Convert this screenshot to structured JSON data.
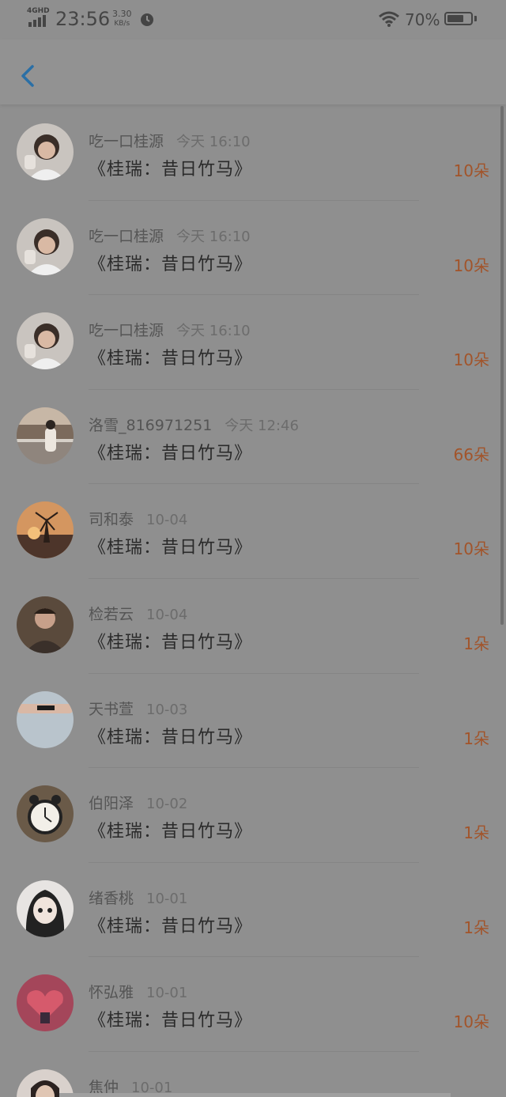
{
  "status_bar": {
    "network": "4GHD",
    "time": "23:56",
    "speed_value": "3.30",
    "speed_unit": "KB/s",
    "battery": "70%",
    "battery_level": 0.7
  },
  "header": {
    "back_icon": "chevron-left-icon",
    "accent": "#2a6fa6"
  },
  "list": [
    {
      "name": "吃一口桂源",
      "date": "今天 16:10",
      "title": "《桂瑞：昔日竹马》",
      "count": "10朵",
      "avatar": "avatar-person-1"
    },
    {
      "name": "吃一口桂源",
      "date": "今天 16:10",
      "title": "《桂瑞：昔日竹马》",
      "count": "10朵",
      "avatar": "avatar-person-1"
    },
    {
      "name": "吃一口桂源",
      "date": "今天 16:10",
      "title": "《桂瑞：昔日竹马》",
      "count": "10朵",
      "avatar": "avatar-person-1"
    },
    {
      "name": "洛雪_816971251",
      "date": "今天 12:46",
      "title": "《桂瑞：昔日竹马》",
      "count": "66朵",
      "avatar": "avatar-girl-street"
    },
    {
      "name": "司和泰",
      "date": "10-04",
      "title": "《桂瑞：昔日竹马》",
      "count": "10朵",
      "avatar": "avatar-windmill"
    },
    {
      "name": "检若云",
      "date": "10-04",
      "title": "《桂瑞：昔日竹马》",
      "count": "1朵",
      "avatar": "avatar-man-dark"
    },
    {
      "name": "天书萱",
      "date": "10-03",
      "title": "《桂瑞：昔日竹马》",
      "count": "1朵",
      "avatar": "avatar-arm-tattoo"
    },
    {
      "name": "伯阳泽",
      "date": "10-02",
      "title": "《桂瑞：昔日竹马》",
      "count": "1朵",
      "avatar": "avatar-alarm-clock"
    },
    {
      "name": "绪香桃",
      "date": "10-01",
      "title": "《桂瑞：昔日竹马》",
      "count": "1朵",
      "avatar": "avatar-anime-girl"
    },
    {
      "name": "怀弘雅",
      "date": "10-01",
      "title": "《桂瑞：昔日竹马》",
      "count": "10朵",
      "avatar": "avatar-red-heart"
    },
    {
      "name": "焦仲",
      "date": "10-01",
      "title": "",
      "count": "",
      "avatar": "avatar-person-bottom"
    }
  ]
}
